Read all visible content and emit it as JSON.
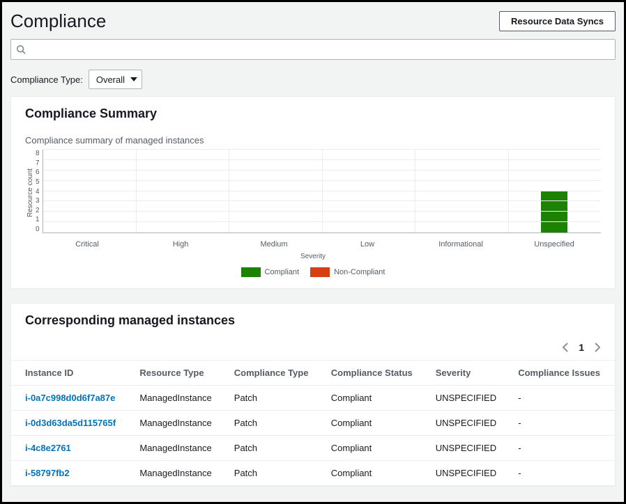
{
  "header": {
    "title": "Compliance",
    "resource_data_syncs_label": "Resource Data Syncs"
  },
  "search": {
    "placeholder": ""
  },
  "filter": {
    "label": "Compliance Type:",
    "selected": "Overall"
  },
  "summary_panel": {
    "title": "Compliance Summary",
    "subtitle": "Compliance summary of managed instances"
  },
  "chart_data": {
    "type": "bar",
    "title": "Compliance summary of managed instances",
    "xlabel": "Severity",
    "ylabel": "Resource count",
    "ylim": [
      0,
      8
    ],
    "yticks": [
      0,
      1,
      2,
      3,
      4,
      5,
      6,
      7,
      8
    ],
    "categories": [
      "Critical",
      "High",
      "Medium",
      "Low",
      "Informational",
      "Unspecified"
    ],
    "series": [
      {
        "name": "Compliant",
        "color": "#1d8102",
        "values": [
          0,
          0,
          0,
          0,
          0,
          4
        ]
      },
      {
        "name": "Non-Compliant",
        "color": "#d63f12",
        "values": [
          0,
          0,
          0,
          0,
          0,
          0
        ]
      }
    ]
  },
  "instances_panel": {
    "title": "Corresponding managed instances",
    "page": "1",
    "columns": [
      "Instance ID",
      "Resource Type",
      "Compliance Type",
      "Compliance Status",
      "Severity",
      "Compliance Issues"
    ],
    "rows": [
      {
        "id": "i-0a7c998d0d6f7a87e",
        "rtype": "ManagedInstance",
        "ctype": "Patch",
        "status": "Compliant",
        "severity": "UNSPECIFIED",
        "issues": "-"
      },
      {
        "id": "i-0d3d63da5d115765f",
        "rtype": "ManagedInstance",
        "ctype": "Patch",
        "status": "Compliant",
        "severity": "UNSPECIFIED",
        "issues": "-"
      },
      {
        "id": "i-4c8e2761",
        "rtype": "ManagedInstance",
        "ctype": "Patch",
        "status": "Compliant",
        "severity": "UNSPECIFIED",
        "issues": "-"
      },
      {
        "id": "i-58797fb2",
        "rtype": "ManagedInstance",
        "ctype": "Patch",
        "status": "Compliant",
        "severity": "UNSPECIFIED",
        "issues": "-"
      }
    ]
  }
}
